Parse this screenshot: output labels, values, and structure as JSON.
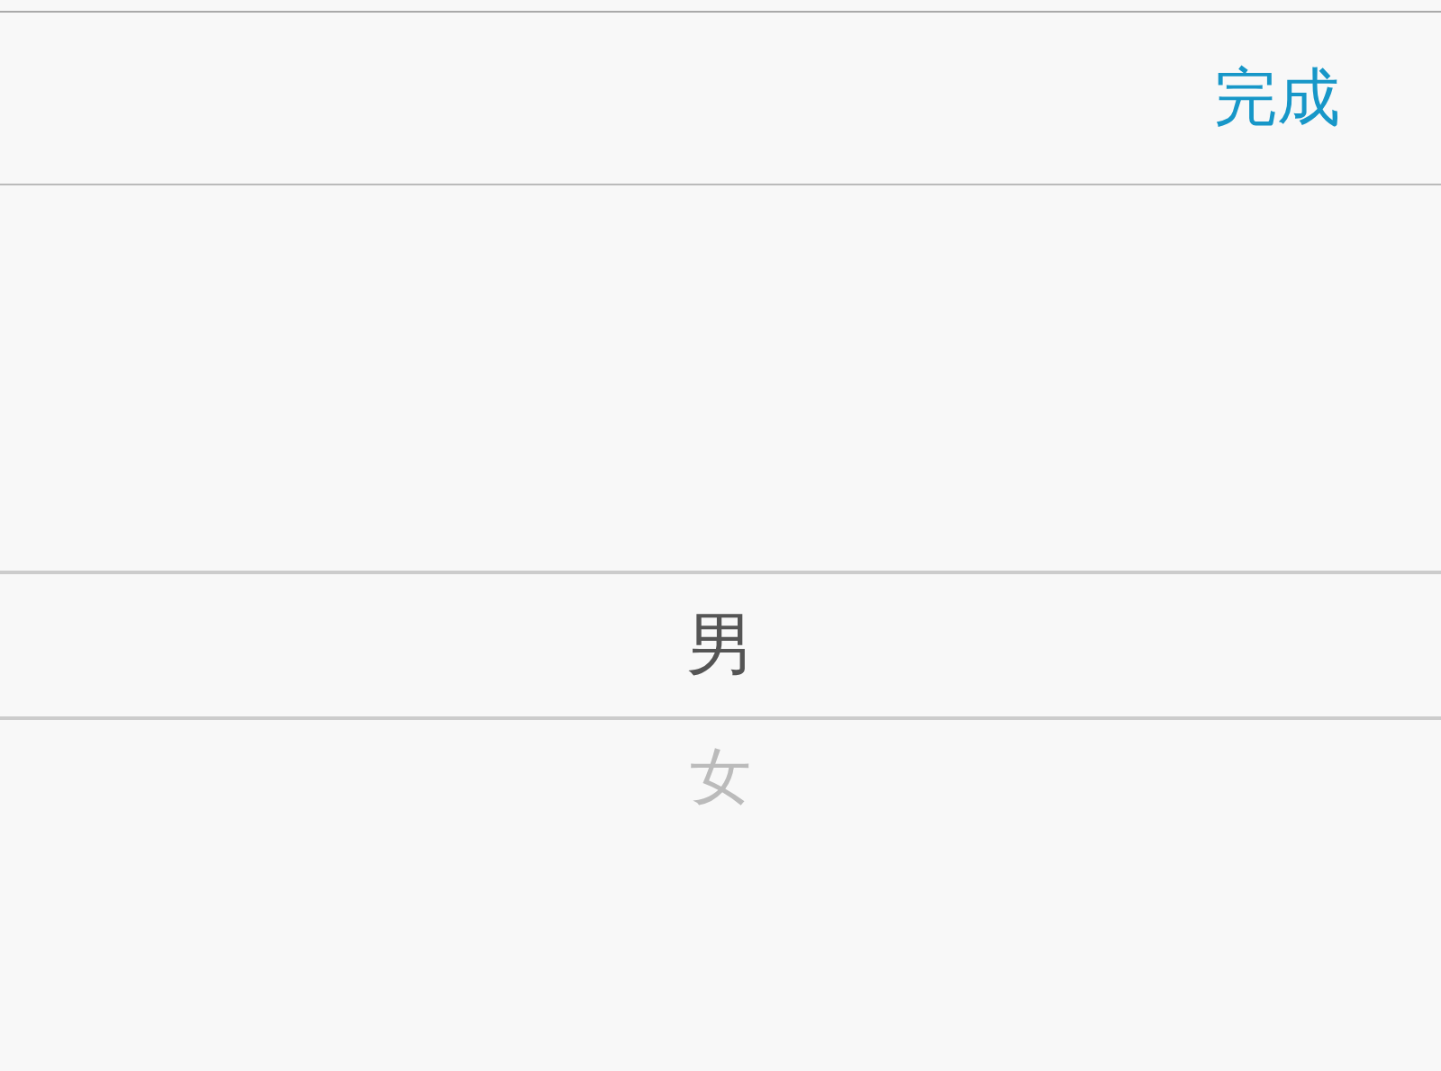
{
  "toolbar": {
    "done_button": "完成"
  },
  "picker": {
    "options": [
      {
        "label": "男",
        "selected": true
      },
      {
        "label": "女",
        "selected": false
      }
    ]
  }
}
